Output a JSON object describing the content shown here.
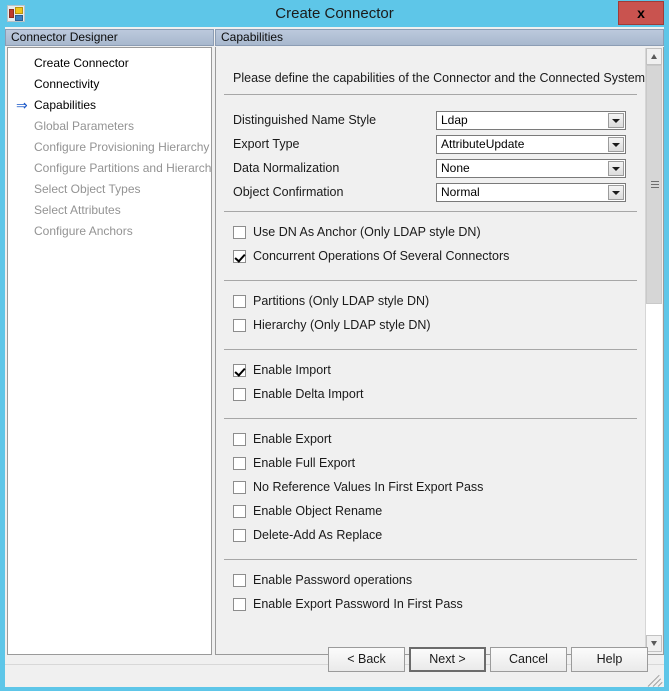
{
  "window": {
    "title": "Create Connector",
    "app_icon": "app-grid-icon",
    "close_label": "x"
  },
  "panels": {
    "left_header": "Connector Designer",
    "right_header": "Capabilities"
  },
  "sidebar": {
    "current_marker": "⇒",
    "items": [
      {
        "label": "Create Connector",
        "enabled": true,
        "current": false
      },
      {
        "label": "Connectivity",
        "enabled": true,
        "current": false
      },
      {
        "label": "Capabilities",
        "enabled": true,
        "current": true
      },
      {
        "label": "Global Parameters",
        "enabled": false,
        "current": false
      },
      {
        "label": "Configure Provisioning Hierarchy",
        "enabled": false,
        "current": false
      },
      {
        "label": "Configure Partitions and Hierarchies",
        "enabled": false,
        "current": false
      },
      {
        "label": "Select Object Types",
        "enabled": false,
        "current": false
      },
      {
        "label": "Select Attributes",
        "enabled": false,
        "current": false
      },
      {
        "label": "Configure Anchors",
        "enabled": false,
        "current": false
      }
    ]
  },
  "content": {
    "intro": "Please define the capabilities of the Connector and the Connected System",
    "fields": [
      {
        "label": "Distinguished Name Style",
        "value": "Ldap"
      },
      {
        "label": "Export Type",
        "value": "AttributeUpdate"
      },
      {
        "label": "Data Normalization",
        "value": "None"
      },
      {
        "label": "Object Confirmation",
        "value": "Normal"
      }
    ],
    "checkbox_groups": [
      {
        "items": [
          {
            "label": "Use DN As Anchor (Only LDAP style DN)",
            "checked": false
          },
          {
            "label": "Concurrent Operations Of Several Connectors",
            "checked": true
          }
        ]
      },
      {
        "items": [
          {
            "label": "Partitions (Only LDAP style DN)",
            "checked": false
          },
          {
            "label": "Hierarchy (Only LDAP style DN)",
            "checked": false
          }
        ]
      },
      {
        "items": [
          {
            "label": "Enable Import",
            "checked": true
          },
          {
            "label": "Enable Delta Import",
            "checked": false
          }
        ]
      },
      {
        "items": [
          {
            "label": "Enable Export",
            "checked": false
          },
          {
            "label": "Enable Full Export",
            "checked": false
          },
          {
            "label": "No Reference Values In First Export Pass",
            "checked": false
          },
          {
            "label": "Enable Object Rename",
            "checked": false
          },
          {
            "label": "Delete-Add As Replace",
            "checked": false
          }
        ]
      },
      {
        "items": [
          {
            "label": "Enable Password operations",
            "checked": false
          },
          {
            "label": "Enable Export Password In First Pass",
            "checked": false
          }
        ]
      }
    ]
  },
  "scrollbar": {
    "up_icon": "chevron-up-icon",
    "down_icon": "chevron-down-icon",
    "thumb_position_percent": 0,
    "thumb_size_percent": 42
  },
  "footer": {
    "buttons": [
      {
        "label": "< Back",
        "name": "back-button",
        "default": false
      },
      {
        "label": "Next  >",
        "name": "next-button",
        "default": true
      },
      {
        "label": "Cancel",
        "name": "cancel-button",
        "default": false
      },
      {
        "label": "Help",
        "name": "help-button",
        "default": false
      }
    ]
  },
  "colors": {
    "titlebar": "#5ec6e8",
    "close_button": "#c9534f",
    "panel_header": "#b0bfd4",
    "content_bg": "#f0f0f0",
    "arrow_marker": "#1a57c8"
  }
}
